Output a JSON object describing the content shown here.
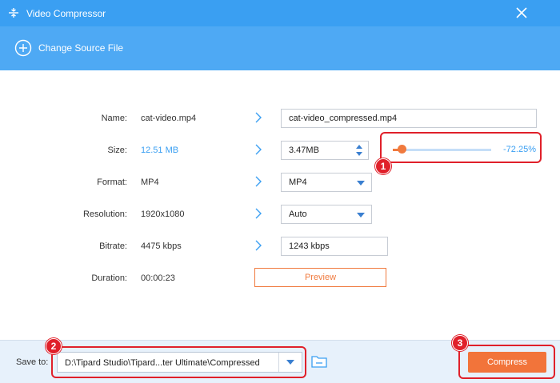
{
  "window": {
    "title": "Video Compressor",
    "close_icon": "close-icon",
    "app_icon": "compressor-icon"
  },
  "toolbar": {
    "change_source_label": "Change Source File",
    "icon": "plus-circle-icon"
  },
  "form": {
    "name": {
      "label": "Name:",
      "source": "cat-video.mp4",
      "output": "cat-video_compressed.mp4"
    },
    "size": {
      "label": "Size:",
      "source": "12.51 MB",
      "output": "3.47MB",
      "percent_label": "-72.25%",
      "slider_fraction": 0.09
    },
    "format": {
      "label": "Format:",
      "source": "MP4",
      "selected": "MP4"
    },
    "resolution": {
      "label": "Resolution:",
      "source": "1920x1080",
      "selected": "Auto"
    },
    "bitrate": {
      "label": "Bitrate:",
      "source": "4475 kbps",
      "output": "1243 kbps"
    },
    "duration": {
      "label": "Duration:",
      "source": "00:00:23"
    },
    "preview_label": "Preview"
  },
  "bottom": {
    "save_to_label": "Save to:",
    "path": "D:\\Tipard Studio\\Tipard...ter Ultimate\\Compressed",
    "compress_label": "Compress",
    "folder_icon": "folder-icon"
  },
  "callouts": [
    "1",
    "2",
    "3"
  ],
  "colors": {
    "title_bar": "#3a9ff2",
    "toolbar": "#4ea9f4",
    "accent_orange": "#f2743a",
    "callout_red": "#e0202a",
    "link_blue": "#3a9ff2"
  }
}
